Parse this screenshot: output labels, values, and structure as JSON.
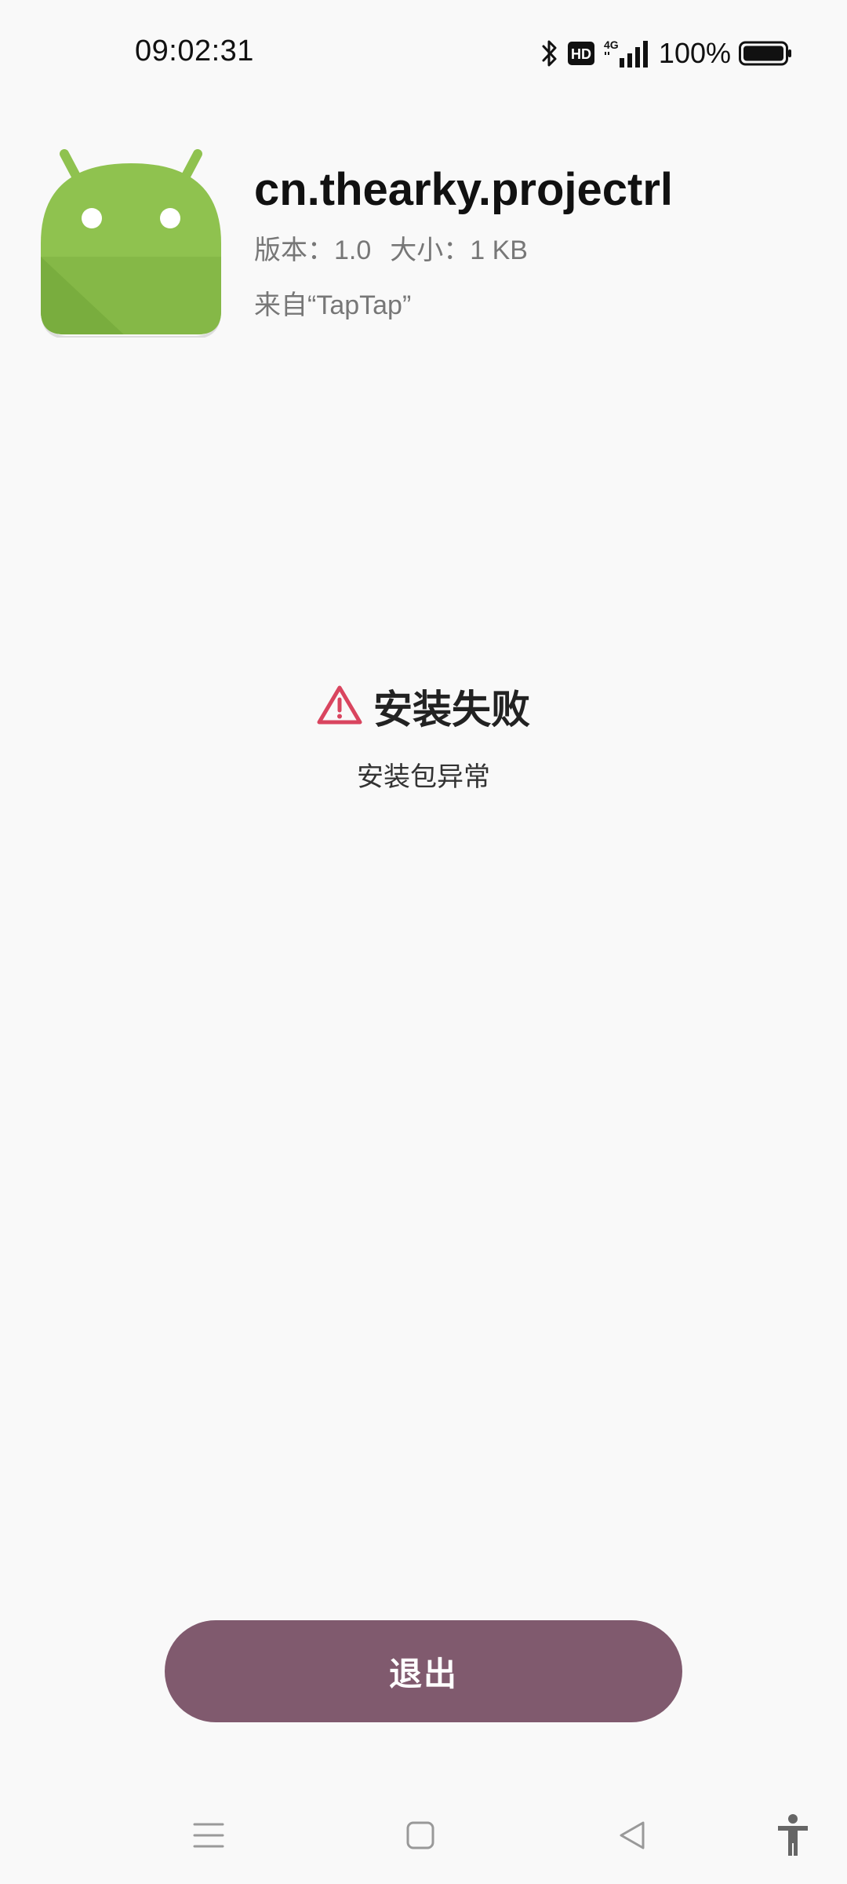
{
  "status_bar": {
    "time": "09:02:31",
    "battery_percent": "100%",
    "icons": [
      "bluetooth-icon",
      "hd-icon",
      "4g-signal-icon",
      "battery-icon"
    ]
  },
  "app": {
    "icon": "android-robot-icon",
    "name": "cn.thearky.projectrl",
    "version": "版本：1.0",
    "size": "大小：1 KB",
    "source": "来自“TapTap”"
  },
  "result": {
    "icon": "warning-icon",
    "title": "安装失败",
    "description": "安装包异常",
    "accent_color": "#d9455f"
  },
  "actions": {
    "exit_label": "退出",
    "button_color": "#805a6e"
  },
  "nav_bar": {
    "icons": [
      "menu-icon",
      "home-icon",
      "back-icon",
      "accessibility-icon"
    ]
  }
}
